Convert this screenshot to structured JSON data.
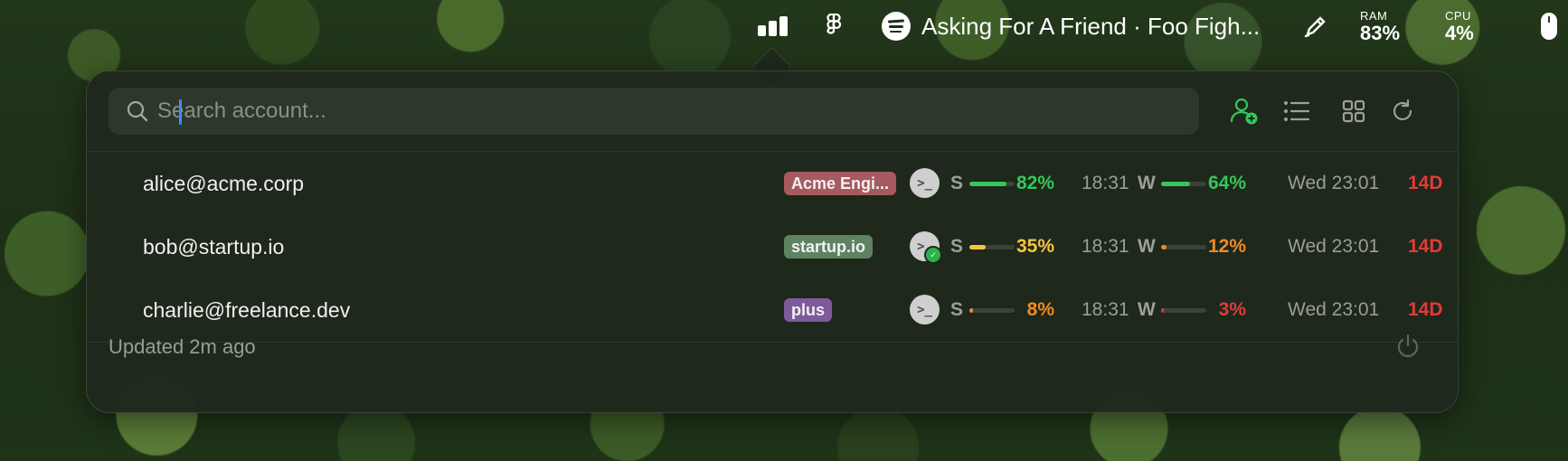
{
  "menubar": {
    "track": "Asking For A Friend · Foo Figh...",
    "ram": {
      "label": "RAM",
      "value": "83%"
    },
    "cpu": {
      "label": "CPU",
      "value": "4%"
    }
  },
  "search": {
    "placeholder": "Search account..."
  },
  "colors": {
    "green": "#34c759",
    "yellow": "#f5c542",
    "orange": "#f08a24",
    "red": "#e23b3b",
    "accent": "#3b8bff"
  },
  "accounts": [
    {
      "email": "alice@acme.corp",
      "badge": {
        "label": "Acme Engi...",
        "color": "#a55a5f"
      },
      "session": {
        "letter": "S",
        "percent": 82,
        "label": "82%",
        "color": "#34c759",
        "reset": "18:31"
      },
      "weekly": {
        "letter": "W",
        "percent": 64,
        "label": "64%",
        "color": "#34c759"
      },
      "weekly_reset": "Wed 23:01",
      "days_left": "14D",
      "active": false
    },
    {
      "email": "bob@startup.io",
      "badge": {
        "label": "startup.io",
        "color": "#5e8262"
      },
      "session": {
        "letter": "S",
        "percent": 35,
        "label": "35%",
        "color": "#f5c542",
        "reset": "18:31"
      },
      "weekly": {
        "letter": "W",
        "percent": 12,
        "label": "12%",
        "color": "#f08a24"
      },
      "weekly_reset": "Wed 23:01",
      "days_left": "14D",
      "active": true
    },
    {
      "email": "charlie@freelance.dev",
      "badge": {
        "label": "plus",
        "color": "#7e5a9a"
      },
      "session": {
        "letter": "S",
        "percent": 8,
        "label": "8%",
        "color": "#f08a24",
        "reset": "18:31"
      },
      "weekly": {
        "letter": "W",
        "percent": 3,
        "label": "3%",
        "color": "#e23b3b"
      },
      "weekly_reset": "Wed 23:01",
      "days_left": "14D",
      "active": false
    }
  ],
  "footer": {
    "updated": "Updated 2m ago"
  }
}
